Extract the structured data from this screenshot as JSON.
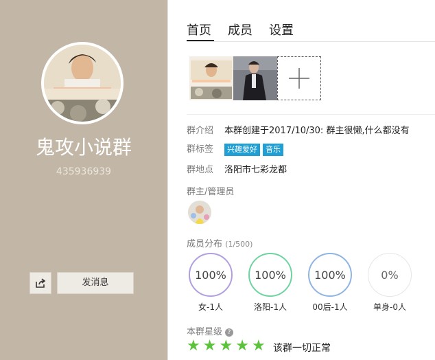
{
  "sidebar": {
    "group_name": "鬼攻小说群",
    "group_id": "435936939",
    "message_button": "发消息"
  },
  "tabs": [
    {
      "label": "首页",
      "active": true
    },
    {
      "label": "成员",
      "active": false
    },
    {
      "label": "设置",
      "active": false
    }
  ],
  "info": {
    "intro_label": "群介绍",
    "intro_text": "本群创建于2017/10/30: 群主很懒,什么都没有",
    "tags_label": "群标签",
    "tags": [
      "兴趣爱好",
      "音乐"
    ],
    "location_label": "群地点",
    "location": "洛阳市七彩龙都",
    "admins_label": "群主/管理员"
  },
  "distribution": {
    "title": "成员分布",
    "count": "(1/500)",
    "stats": [
      {
        "percent": "100%",
        "label": "女-1人",
        "color": "#b19ee0"
      },
      {
        "percent": "100%",
        "label": "洛阳-1人",
        "color": "#6fd3a0"
      },
      {
        "percent": "100%",
        "label": "00后-1人",
        "color": "#8fb4e2"
      },
      {
        "percent": "0%",
        "label": "单身-0人",
        "color": "#ececec"
      }
    ]
  },
  "rating": {
    "title": "本群星级",
    "stars": 5,
    "status": "该群一切正常"
  },
  "colors": {
    "sidebar_bg": "#c2b7a7",
    "tag_bg": "#1f9fd4",
    "star": "#5bc23b"
  }
}
